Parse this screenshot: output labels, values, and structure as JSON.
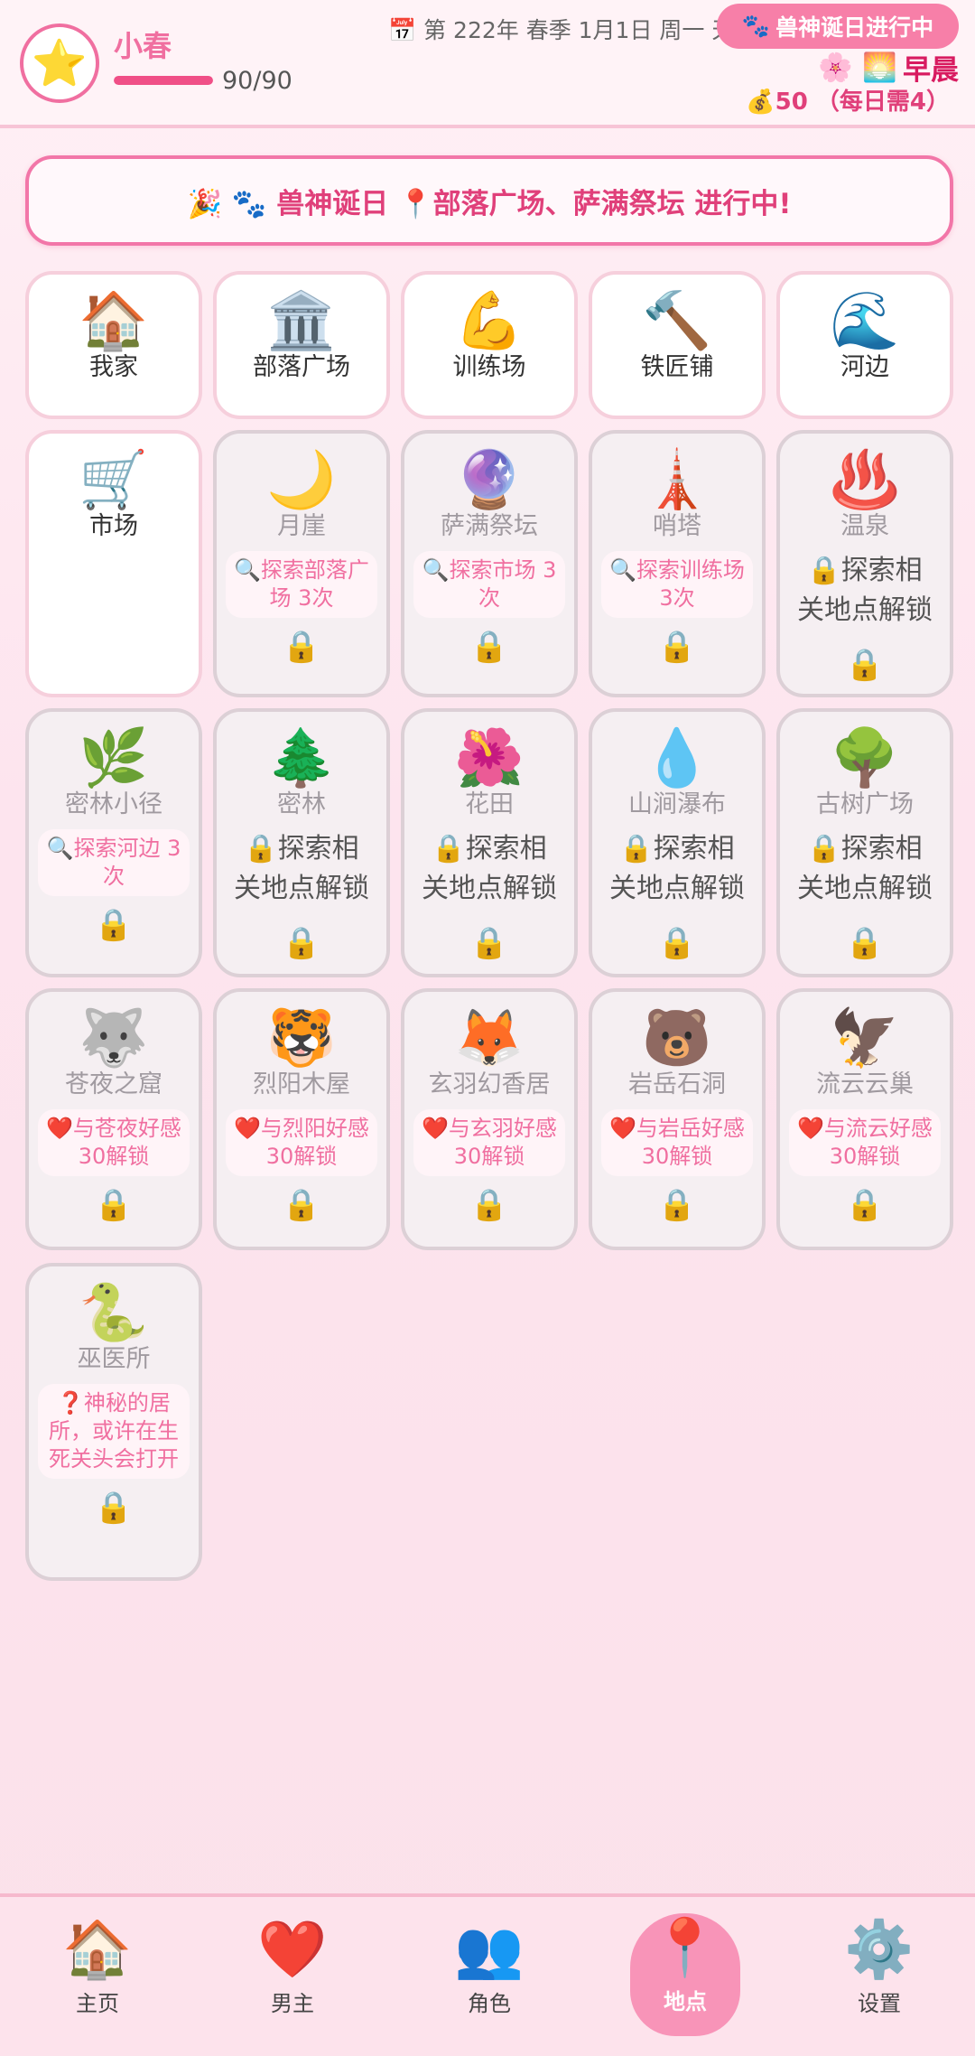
{
  "header": {
    "avatar_icon": "⭐",
    "player_name": "小春",
    "hp_value": "90/90",
    "hp_fraction": 1.0,
    "date_icon": "📅",
    "date_text": "第 222年 春季 1月1日 周一 天",
    "event_icon": "🐾",
    "event_label": "兽神诞日进行中",
    "time_icons": "🌸 🌅",
    "time_label": "早晨",
    "money_icon": "💰",
    "money_text": "50 （每日需4）"
  },
  "banner": {
    "text": "🎉 🐾 兽神诞日 📍部落广场、萨满祭坛 进行中!"
  },
  "locations": [
    {
      "icon": "🏠",
      "name": "我家",
      "locked": false
    },
    {
      "icon": "🏛️",
      "name": "部落广场",
      "locked": false
    },
    {
      "icon": "💪",
      "name": "训练场",
      "locked": false
    },
    {
      "icon": "🔨",
      "name": "铁匠铺",
      "locked": false
    },
    {
      "icon": "🌊",
      "name": "河边",
      "locked": false
    },
    {
      "icon": "🛒",
      "name": "市场",
      "locked": false
    },
    {
      "icon": "🌙",
      "name": "月崖",
      "locked": true,
      "hint": "🔍探索部落广场 3次",
      "lock": "🔒"
    },
    {
      "icon": "🔮",
      "name": "萨满祭坛",
      "locked": true,
      "hint": "🔍探索市场 3次",
      "lock": "🔒"
    },
    {
      "icon": "🗼",
      "name": "哨塔",
      "locked": true,
      "hint": "🔍探索训练场 3次",
      "lock": "🔒"
    },
    {
      "icon": "♨️",
      "name": "温泉",
      "locked": true,
      "hint": "🔒探索相关地点解锁",
      "lock": "🔒"
    },
    {
      "icon": "🌿",
      "name": "密林小径",
      "locked": true,
      "hint": "🔍探索河边 3次",
      "lock": "🔒"
    },
    {
      "icon": "🌲",
      "name": "密林",
      "locked": true,
      "hint": "🔒探索相关地点解锁",
      "lock": "🔒"
    },
    {
      "icon": "🌺",
      "name": "花田",
      "locked": true,
      "hint": "🔒探索相关地点解锁",
      "lock": "🔒"
    },
    {
      "icon": "💧",
      "name": "山涧瀑布",
      "locked": true,
      "hint": "🔒探索相关地点解锁",
      "lock": "🔒"
    },
    {
      "icon": "🌳",
      "name": "古树广场",
      "locked": true,
      "hint": "🔒探索相关地点解锁",
      "lock": "🔒"
    },
    {
      "icon": "🐺",
      "name": "苍夜之窟",
      "locked": true,
      "hint": "❤️与苍夜好感30解锁",
      "lock": "🔒"
    },
    {
      "icon": "🐯",
      "name": "烈阳木屋",
      "locked": true,
      "hint": "❤️与烈阳好感30解锁",
      "lock": "🔒"
    },
    {
      "icon": "🦊",
      "name": "玄羽幻香居",
      "locked": true,
      "hint": "❤️与玄羽好感30解锁",
      "lock": "🔒"
    },
    {
      "icon": "🐻",
      "name": "岩岳石洞",
      "locked": true,
      "hint": "❤️与岩岳好感30解锁",
      "lock": "🔒"
    },
    {
      "icon": "🦅",
      "name": "流云云巢",
      "locked": true,
      "hint": "❤️与流云好感30解锁",
      "lock": "🔒"
    },
    {
      "icon": "🐍",
      "name": "巫医所",
      "locked": true,
      "hint": "❓神秘的居所，或许在生死关头会打开",
      "lock": "🔒"
    }
  ],
  "nav": [
    {
      "icon": "🏠",
      "label": "主页"
    },
    {
      "icon": "❤️",
      "label": "男主"
    },
    {
      "icon": "👥",
      "label": "角色"
    },
    {
      "icon": "📍",
      "label": "地点",
      "active": true
    },
    {
      "icon": "⚙️",
      "label": "设置"
    }
  ]
}
